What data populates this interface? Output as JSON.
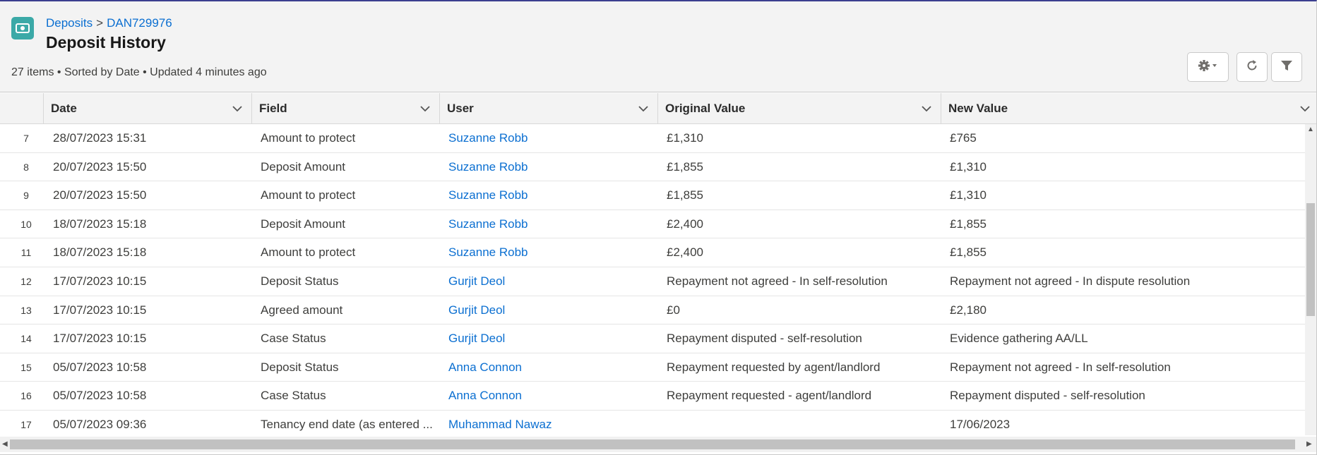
{
  "breadcrumb": {
    "parent": "Deposits",
    "separator": ">",
    "current": "DAN729976"
  },
  "title": "Deposit History",
  "meta": "27 items • Sorted by Date • Updated 4 minutes ago",
  "accent_color": "#3ba9a7",
  "link_color": "#0b6fd1",
  "icons": {
    "object": "deposit-icon",
    "settings": "gear-icon",
    "refresh": "refresh-icon",
    "filter": "filter-icon"
  },
  "columns": {
    "date": "Date",
    "field": "Field",
    "user": "User",
    "original": "Original Value",
    "new": "New Value"
  },
  "rows": [
    {
      "num": "7",
      "date": "28/07/2023 15:31",
      "field": "Amount to protect",
      "user": "Suzanne Robb",
      "original": "£1,310",
      "new": "£765"
    },
    {
      "num": "8",
      "date": "20/07/2023 15:50",
      "field": "Deposit Amount",
      "user": "Suzanne Robb",
      "original": "£1,855",
      "new": "£1,310"
    },
    {
      "num": "9",
      "date": "20/07/2023 15:50",
      "field": "Amount to protect",
      "user": "Suzanne Robb",
      "original": "£1,855",
      "new": "£1,310"
    },
    {
      "num": "10",
      "date": "18/07/2023 15:18",
      "field": "Deposit Amount",
      "user": "Suzanne Robb",
      "original": "£2,400",
      "new": "£1,855"
    },
    {
      "num": "11",
      "date": "18/07/2023 15:18",
      "field": "Amount to protect",
      "user": "Suzanne Robb",
      "original": "£2,400",
      "new": "£1,855"
    },
    {
      "num": "12",
      "date": "17/07/2023 10:15",
      "field": "Deposit Status",
      "user": "Gurjit Deol",
      "original": "Repayment not agreed - In self-resolution",
      "new": "Repayment not agreed - In dispute resolution"
    },
    {
      "num": "13",
      "date": "17/07/2023 10:15",
      "field": "Agreed amount",
      "user": "Gurjit Deol",
      "original": "£0",
      "new": "£2,180"
    },
    {
      "num": "14",
      "date": "17/07/2023 10:15",
      "field": "Case Status",
      "user": "Gurjit Deol",
      "original": "Repayment disputed - self-resolution",
      "new": "Evidence gathering AA/LL"
    },
    {
      "num": "15",
      "date": "05/07/2023 10:58",
      "field": "Deposit Status",
      "user": "Anna Connon",
      "original": "Repayment requested by agent/landlord",
      "new": "Repayment not agreed - In self-resolution"
    },
    {
      "num": "16",
      "date": "05/07/2023 10:58",
      "field": "Case Status",
      "user": "Anna Connon",
      "original": "Repayment requested - agent/landlord",
      "new": "Repayment disputed - self-resolution"
    },
    {
      "num": "17",
      "date": "05/07/2023 09:36",
      "field": "Tenancy end date (as entered ...",
      "user": "Muhammad Nawaz",
      "original": "",
      "new": "17/06/2023"
    }
  ]
}
